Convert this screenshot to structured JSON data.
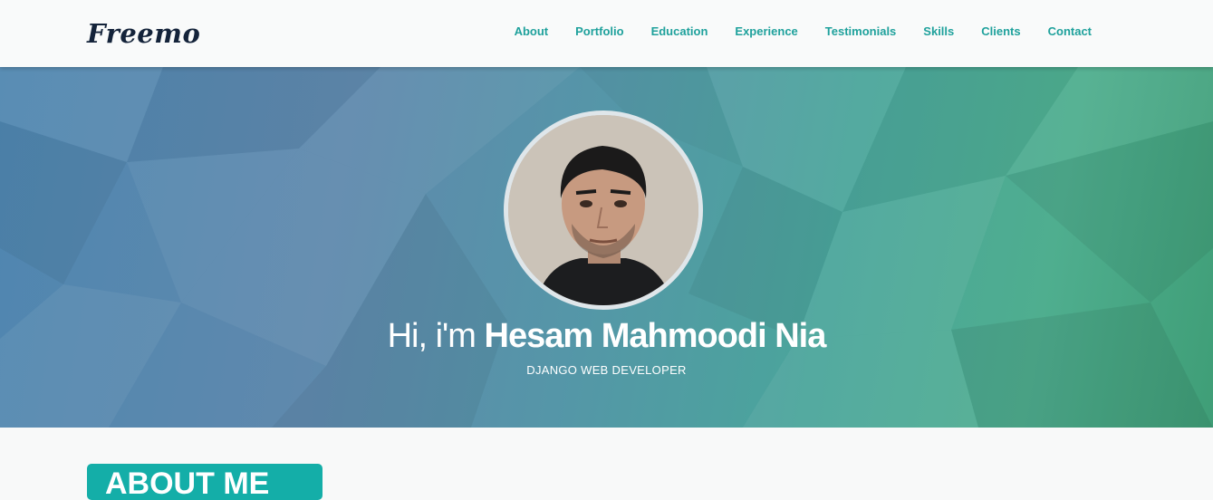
{
  "brand": {
    "logo": "Freemo"
  },
  "nav": {
    "items": [
      {
        "label": "About"
      },
      {
        "label": "Portfolio"
      },
      {
        "label": "Education"
      },
      {
        "label": "Experience"
      },
      {
        "label": "Testimonials"
      },
      {
        "label": "Skills"
      },
      {
        "label": "Clients"
      },
      {
        "label": "Contact"
      }
    ]
  },
  "hero": {
    "greeting": "Hi, i'm",
    "name": "Hesam Mahmoodi Nia",
    "subtitle": "DJANGO WEB DEVELOPER"
  },
  "section": {
    "about_heading": "ABOUT ME"
  },
  "colors": {
    "accent": "#1fa19c",
    "logo": "#14233a",
    "badge": "#14aea8"
  }
}
